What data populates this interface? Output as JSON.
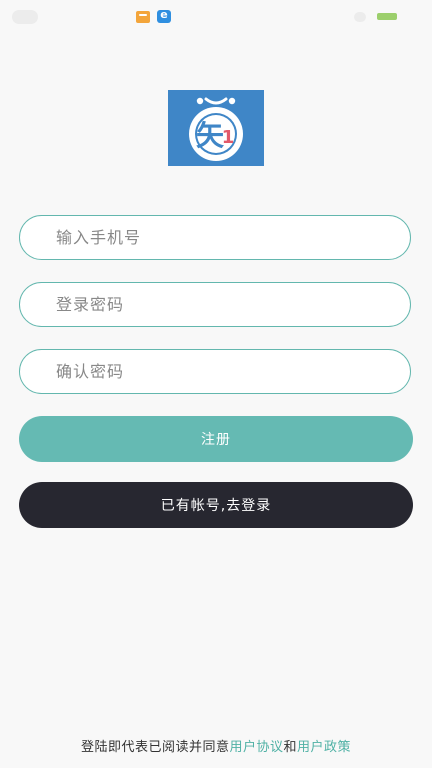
{
  "form": {
    "phone_placeholder": "输入手机号",
    "password_placeholder": "登录密码",
    "confirm_placeholder": "确认密码",
    "phone_value": "",
    "password_value": "",
    "confirm_value": ""
  },
  "buttons": {
    "register_label": "注册",
    "login_label": "已有帐号,去登录"
  },
  "agreement": {
    "prefix": "登陆即代表已阅读并同意",
    "user_agreement": "用户协议",
    "and": "和",
    "user_policy": "用户政策"
  },
  "colors": {
    "accent": "#65bab3",
    "dark_button": "#272730",
    "link": "#4fb1a5",
    "logo_bg": "#3f86c7"
  },
  "icons": {
    "logo": "zhi-logo-icon",
    "status_app_1": "mail-app-icon",
    "status_app_2": "browser-app-icon",
    "battery": "battery-icon"
  }
}
